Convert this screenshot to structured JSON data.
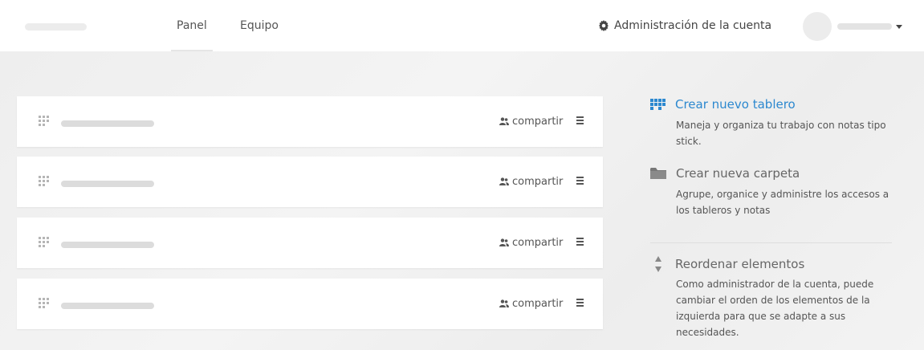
{
  "nav": {
    "tabs": [
      {
        "label": "Panel",
        "active": true
      },
      {
        "label": "Equipo",
        "active": false
      }
    ],
    "account_admin_label": "Administración de la cuenta",
    "account_admin_icon": "gear-icon",
    "user_menu_icon": "caret-down-icon"
  },
  "boards": [
    {
      "share_label": "compartir",
      "share_icon": "users-icon",
      "menu_icon": "hamburger-icon",
      "drag_icon": "grip-icon"
    },
    {
      "share_label": "compartir",
      "share_icon": "users-icon",
      "menu_icon": "hamburger-icon",
      "drag_icon": "grip-icon"
    },
    {
      "share_label": "compartir",
      "share_icon": "users-icon",
      "menu_icon": "hamburger-icon",
      "drag_icon": "grip-icon"
    },
    {
      "share_label": "compartir",
      "share_icon": "users-icon",
      "menu_icon": "hamburger-icon",
      "drag_icon": "grip-icon"
    }
  ],
  "sidebar": {
    "create_board": {
      "title": "Crear nuevo tablero",
      "description": "Maneja y organiza tu trabajo con notas tipo stick.",
      "icon": "board-icon"
    },
    "create_folder": {
      "title": "Crear nueva carpeta",
      "description": "Agrupe, organice y administre los accesos a los tableros y notas",
      "icon": "folder-icon"
    },
    "reorder": {
      "title": "Reordenar elementos",
      "description": "Como administrador de la cuenta, puede cambiar el orden de los elementos de la izquierda para que se adapte a sus necesidades.",
      "icon": "sort-arrows-icon"
    }
  },
  "colors": {
    "accent": "#2c88cf",
    "background": "#f0f0f0",
    "card": "#ffffff"
  }
}
